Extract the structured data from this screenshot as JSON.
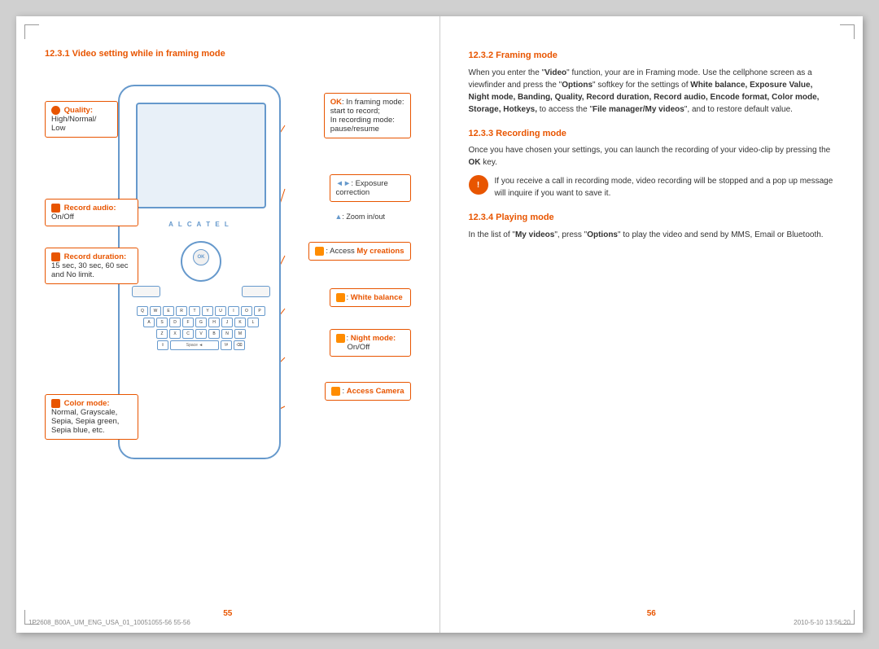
{
  "leftPage": {
    "number": "55",
    "sectionTitle": "12.3.1   Video setting while in framing mode",
    "callouts": {
      "quality": {
        "label": "Quality:",
        "desc": "High/Normal/\nLow"
      },
      "recordAudio": {
        "label": "Record audio:",
        "desc": "On/Off"
      },
      "recordDuration": {
        "label": "Record duration:",
        "desc": "15 sec, 30 sec, 60 sec and No limit."
      },
      "colorMode": {
        "label": "Color mode:",
        "desc": "Normal, Grayscale, Sepia, Sepia green, Sepia blue, etc."
      }
    },
    "calloutsRight": {
      "framingMode": {
        "desc": ": In framing mode: start to record; In recording mode: pause/resume"
      },
      "exposure": {
        "desc": ": Exposure correction"
      },
      "zoom": {
        "desc": ": Zoom in/out"
      },
      "accessCreations": {
        "desc": ": Access My creations"
      },
      "whiteBalance": {
        "label": "White balance"
      },
      "nightMode": {
        "label": "Night mode:",
        "desc": "On/Off"
      },
      "accessCamera": {
        "label": "Access Camera"
      }
    }
  },
  "rightPage": {
    "number": "56",
    "sections": [
      {
        "id": "12.3.2",
        "title": "Framing mode",
        "body": "When you enter the \"Video\" function, your are in Framing mode. Use the cellphone screen as a viewfinder and press the \"Options\" softkey for the settings of White balance, Exposure Value, Night mode, Banding, Quality, Record duration, Record audio, Encode format, Color mode, Storage, Hotkeys, to access the \"File manager/My videos\", and to restore default value."
      },
      {
        "id": "12.3.3",
        "title": "Recording mode",
        "body": "Once you have chosen your settings, you can launch the recording of your video-clip by pressing the OK key.",
        "note": "If you receive a call in recording mode, video recording will be stopped and a pop up message will inquire if you want to save it."
      },
      {
        "id": "12.3.4",
        "title": "Playing mode",
        "body": "In the list of \"My videos\", press \"Options\" to play the video and send by MMS, Email or Bluetooth."
      }
    ]
  },
  "footer": {
    "leftInfo": "1P2608_B00A_UM_ENG_USA_01_10051055-56    55-56",
    "rightInfo": "2010-5-10    13:56:20"
  },
  "phone": {
    "brand": "A L C A T E L",
    "navLabel": "OK",
    "spaceLabel": "Space ◄",
    "rows": [
      [
        "Q",
        "W",
        "E",
        "R",
        "T",
        "Y",
        "U",
        "I",
        "O",
        "P"
      ],
      [
        "A",
        "S",
        "D",
        "F",
        "G",
        "H",
        "J",
        "K",
        "L"
      ],
      [
        "Z",
        "X",
        "C",
        "V",
        "B",
        "N",
        "M"
      ]
    ]
  }
}
